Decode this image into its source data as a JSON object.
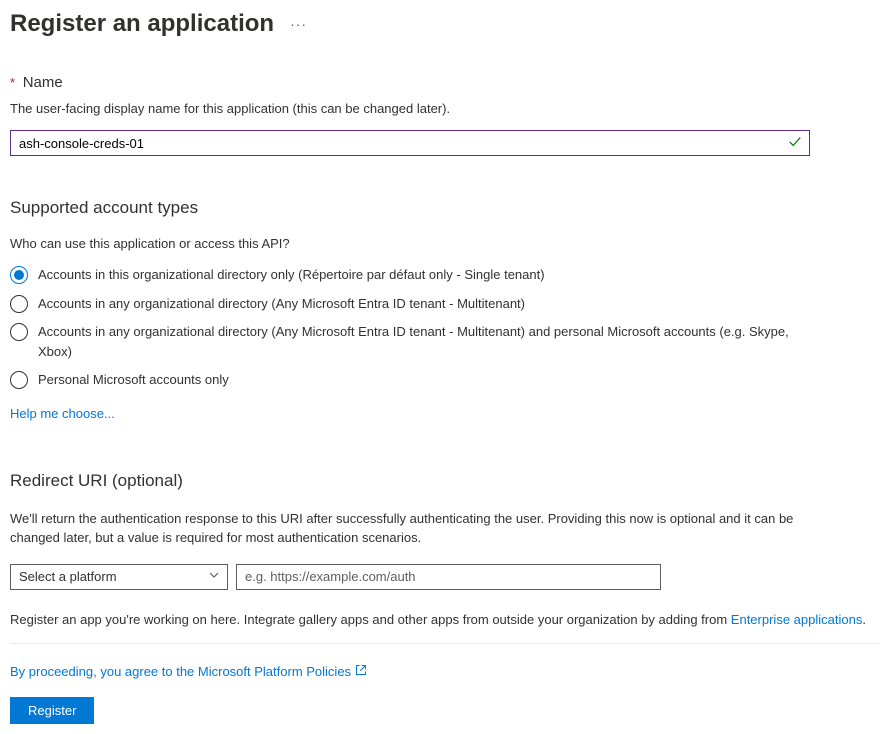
{
  "page": {
    "title": "Register an application"
  },
  "name_section": {
    "label": "Name",
    "help": "The user-facing display name for this application (this can be changed later).",
    "value": "ash-console-creds-01"
  },
  "account_types": {
    "title": "Supported account types",
    "subtitle": "Who can use this application or access this API?",
    "options": [
      "Accounts in this organizational directory only (Répertoire par défaut only - Single tenant)",
      "Accounts in any organizational directory (Any Microsoft Entra ID tenant - Multitenant)",
      "Accounts in any organizational directory (Any Microsoft Entra ID tenant - Multitenant) and personal Microsoft accounts (e.g. Skype, Xbox)",
      "Personal Microsoft accounts only"
    ],
    "help_link": "Help me choose..."
  },
  "redirect": {
    "title": "Redirect URI (optional)",
    "desc": "We'll return the authentication response to this URI after successfully authenticating the user. Providing this now is optional and it can be changed later, but a value is required for most authentication scenarios.",
    "platform_placeholder": "Select a platform",
    "url_placeholder": "e.g. https://example.com/auth"
  },
  "footer": {
    "text_prefix": "Register an app you're working on here. Integrate gallery apps and other apps from outside your organization by adding from ",
    "link": "Enterprise applications",
    "text_suffix": ".",
    "policy_text": "By proceeding, you agree to the Microsoft Platform Policies",
    "register_label": "Register"
  }
}
